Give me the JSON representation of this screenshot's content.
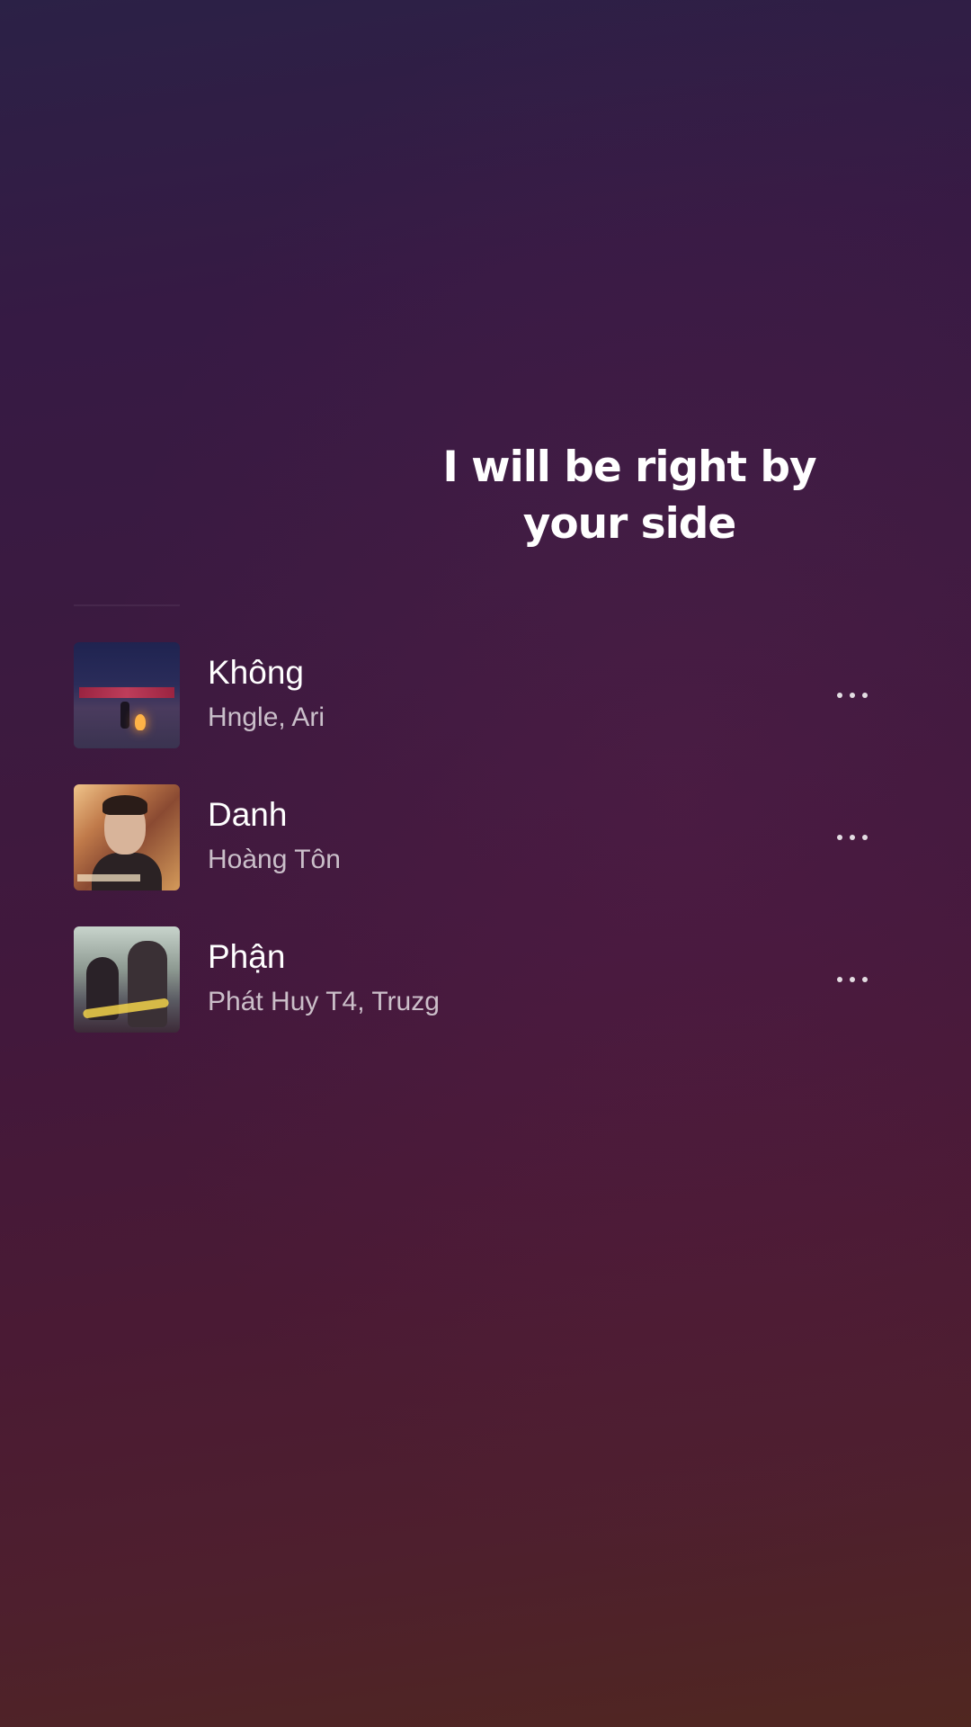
{
  "lyrics": {
    "line_1": "I will be right by",
    "line_2": "your side"
  },
  "tracks": [
    {
      "title": "Không",
      "artist": "Hngle, Ari",
      "art_icon": "album-cover-image",
      "menu_icon": "more-options-icon"
    },
    {
      "title": "Danh",
      "artist": "Hoàng Tôn",
      "art_icon": "album-cover-image",
      "menu_icon": "more-options-icon"
    },
    {
      "title": "Phận",
      "artist": "Phát Huy T4, Truzg",
      "art_icon": "album-cover-image",
      "menu_icon": "more-options-icon"
    }
  ],
  "colors": {
    "background_top": "#2b2146",
    "background_middle": "#42183c",
    "background_bottom": "#502720",
    "text_primary": "#ffffff",
    "text_secondary": "#c8bcc8"
  }
}
